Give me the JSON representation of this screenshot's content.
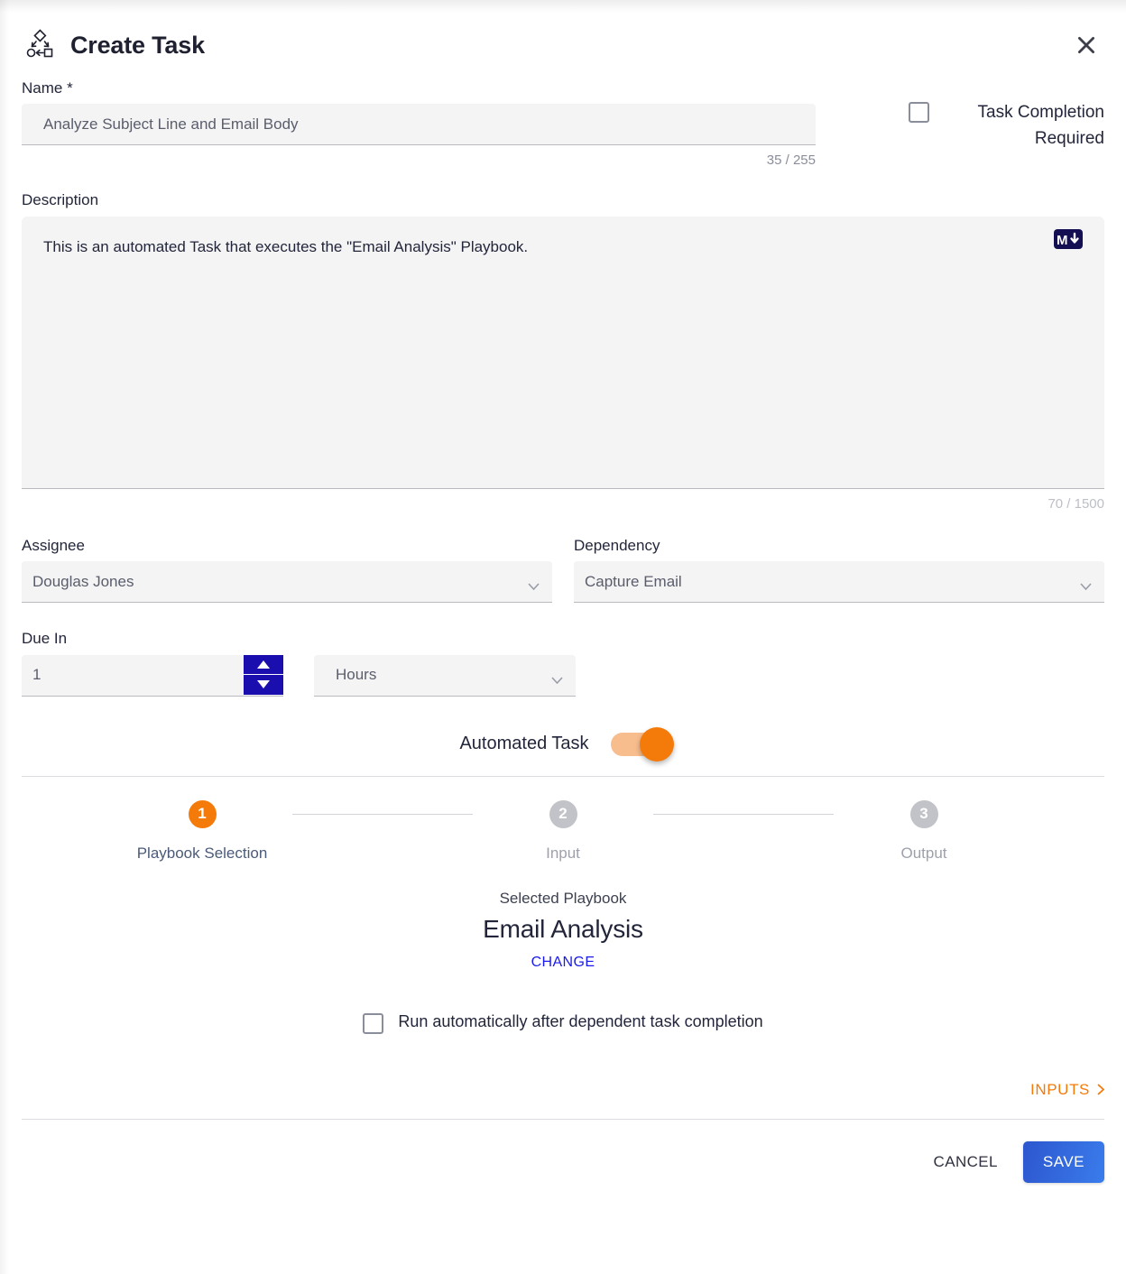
{
  "header": {
    "title": "Create Task",
    "icon": "workflow-diagram-icon",
    "close_icon": "close-icon"
  },
  "name_field": {
    "label": "Name *",
    "value": "Analyze Subject Line and Email Body",
    "placeholder": "Name",
    "counter": "35 / 255"
  },
  "task_completion": {
    "label": "Task Completion Required",
    "checked": false
  },
  "description_field": {
    "label": "Description",
    "value": "This is an automated Task that executes the \"Email Analysis\" Playbook.",
    "placeholder": "Description",
    "counter": "70 / 1500",
    "markdown_badge": "M"
  },
  "assignee": {
    "label": "Assignee",
    "value": "Douglas Jones"
  },
  "dependency": {
    "label": "Dependency",
    "value": "Capture Email"
  },
  "due_in": {
    "label": "Due In",
    "value": "1",
    "unit": "Hours"
  },
  "automated_task": {
    "label": "Automated Task",
    "enabled": true,
    "accent": "#f47b0a"
  },
  "stepper": {
    "steps": [
      {
        "number": "1",
        "label": "Playbook Selection",
        "state": "active"
      },
      {
        "number": "2",
        "label": "Input",
        "state": "inactive"
      },
      {
        "number": "3",
        "label": "Output",
        "state": "inactive"
      }
    ]
  },
  "playbook": {
    "caption": "Selected Playbook",
    "name": "Email Analysis",
    "change_label": "CHANGE"
  },
  "run_automatically": {
    "label": "Run automatically after dependent task completion",
    "checked": false
  },
  "inputs_link": {
    "label": "INPUTS",
    "chevron": "chevron-right-icon"
  },
  "footer": {
    "cancel_label": "CANCEL",
    "save_label": "SAVE"
  },
  "colors": {
    "accent_orange": "#f47b0a",
    "primary_blue": "#3a7ceb",
    "link_blue": "#1a1aee",
    "spinner_blue": "#1a0fae",
    "field_bg": "#f4f4f5",
    "text_dark": "#23263a"
  }
}
